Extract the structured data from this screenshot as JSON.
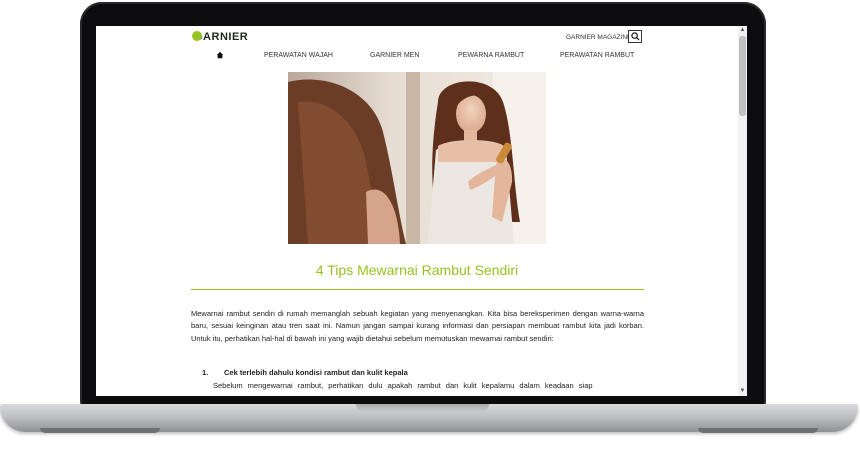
{
  "header": {
    "logo": "GARNIER",
    "magazine_link": "GARNIER MAGAZINE"
  },
  "nav": {
    "items": [
      {
        "label": "PERAWATAN WAJAH"
      },
      {
        "label": "GARNIER MEN"
      },
      {
        "label": "PEWARNA RAMBUT"
      },
      {
        "label": "PERAWATAN RAMBUT"
      }
    ]
  },
  "article": {
    "title": "4 Tips Mewarnai Rambut Sendiri",
    "intro": "Mewarnai rambut sendiri di rumah memanglah sebuah kegiatan yang menyenangkan. Kita bisa bereksperimen dengan warna-warna baru, sesuai keinginan atau tren saat ini. Namun jangan sampai kurang informasi dan persiapan membuat rambut kita jadi korban. Untuk itu, perhatikan hal-hal di bawah ini yang wajib dietahui sebelum memutuskan mewarnai rambut sendiri:",
    "step1_number": "1.",
    "step1_heading": "Cek terlebih dahulu kondisi rambut dan kulit kepala",
    "step1_body": "Sebelum mengewarnai rambut, perhatikan dulu apakah rambut dan kulit kepalamu dalam keadaan siap"
  },
  "colors": {
    "accent": "#97c21f",
    "text": "#222222"
  },
  "icons": {
    "search": "search-icon",
    "home": "home-icon"
  }
}
